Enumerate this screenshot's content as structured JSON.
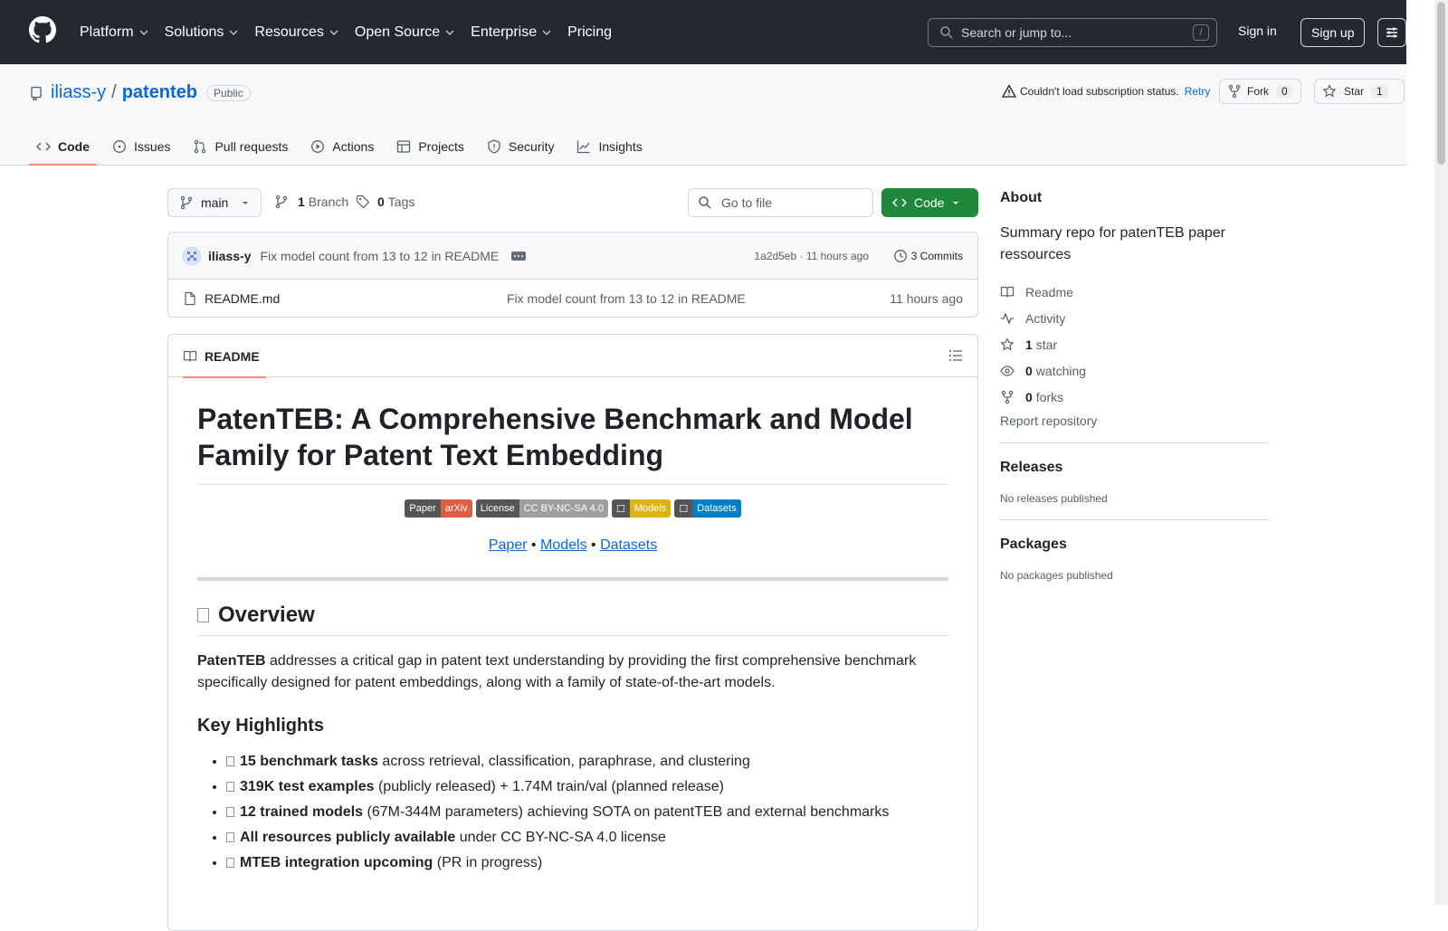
{
  "header": {
    "nav": [
      "Platform",
      "Solutions",
      "Resources",
      "Open Source",
      "Enterprise"
    ],
    "pricing": "Pricing",
    "search_placeholder": "Search or jump to...",
    "search_hotkey": "/",
    "sign_in": "Sign in",
    "sign_up": "Sign up"
  },
  "repo": {
    "owner": "iliass-y",
    "separator": "/",
    "name": "patenteb",
    "visibility": "Public",
    "subscription_status": "Couldn't load subscription status.",
    "retry": "Retry",
    "fork_label": "Fork",
    "fork_count": "0",
    "star_label": "Star",
    "star_count": "1",
    "tabs": [
      "Code",
      "Issues",
      "Pull requests",
      "Actions",
      "Projects",
      "Security",
      "Insights"
    ],
    "active_tab": "Code"
  },
  "files": {
    "branch": "main",
    "branch_count": "1",
    "branch_label": "Branch",
    "tag_count": "0",
    "tag_label": "Tags",
    "goto_placeholder": "Go to file",
    "code_button": "Code",
    "latest_commit": {
      "author": "iliass-y",
      "message": "Fix model count from 13 to 12 in README",
      "hash": "1a2d5eb",
      "time": "11 hours ago",
      "commits": "3 Commits"
    },
    "rows": [
      {
        "name": "README.md",
        "message": "Fix model count from 13 to 12 in README",
        "time": "11 hours ago"
      }
    ]
  },
  "readme": {
    "tab_label": "README",
    "title": "PatenTEB: A Comprehensive Benchmark and Model Family for Patent Text Embedding",
    "badges": [
      {
        "left": "Paper",
        "right": "arXiv",
        "color": "#e05d44"
      },
      {
        "left": "License",
        "right": "CC BY-NC-SA 4.0",
        "color": "#9f9f9f"
      },
      {
        "left": "☐",
        "right": "Models",
        "color": "#dfb317"
      },
      {
        "left": "☐",
        "right": "Datasets",
        "color": "#007ec6"
      }
    ],
    "links": [
      "Paper",
      "Models",
      "Datasets"
    ],
    "link_sep": "•",
    "overview_heading": "Overview",
    "overview_bold": "PatenTEB",
    "overview_text": " addresses a critical gap in patent text understanding by providing the first comprehensive benchmark specifically designed for patent embeddings, along with a family of state-of-the-art models.",
    "highlights_heading": "Key Highlights",
    "highlights": [
      {
        "bold": "15 benchmark tasks",
        "text": " across retrieval, classification, paraphrase, and clustering"
      },
      {
        "bold": "319K test examples",
        "text": " (publicly released) + 1.74M train/val (planned release)"
      },
      {
        "bold": "12 trained models",
        "text": " (67M-344M parameters) achieving SOTA on patentTEB and external benchmarks"
      },
      {
        "bold": "All resources publicly available",
        "text": " under CC BY-NC-SA 4.0 license"
      },
      {
        "bold": "MTEB integration upcoming",
        "text": " (PR in progress)"
      }
    ]
  },
  "sidebar": {
    "about_heading": "About",
    "about_desc": "Summary repo for patenTEB paper ressources",
    "readme": "Readme",
    "activity": "Activity",
    "stars_count": "1",
    "stars_label": "star",
    "watching_count": "0",
    "watching_label": "watching",
    "forks_count": "0",
    "forks_label": "forks",
    "report": "Report repository",
    "releases_heading": "Releases",
    "releases_note": "No releases published",
    "packages_heading": "Packages",
    "packages_note": "No packages published"
  }
}
